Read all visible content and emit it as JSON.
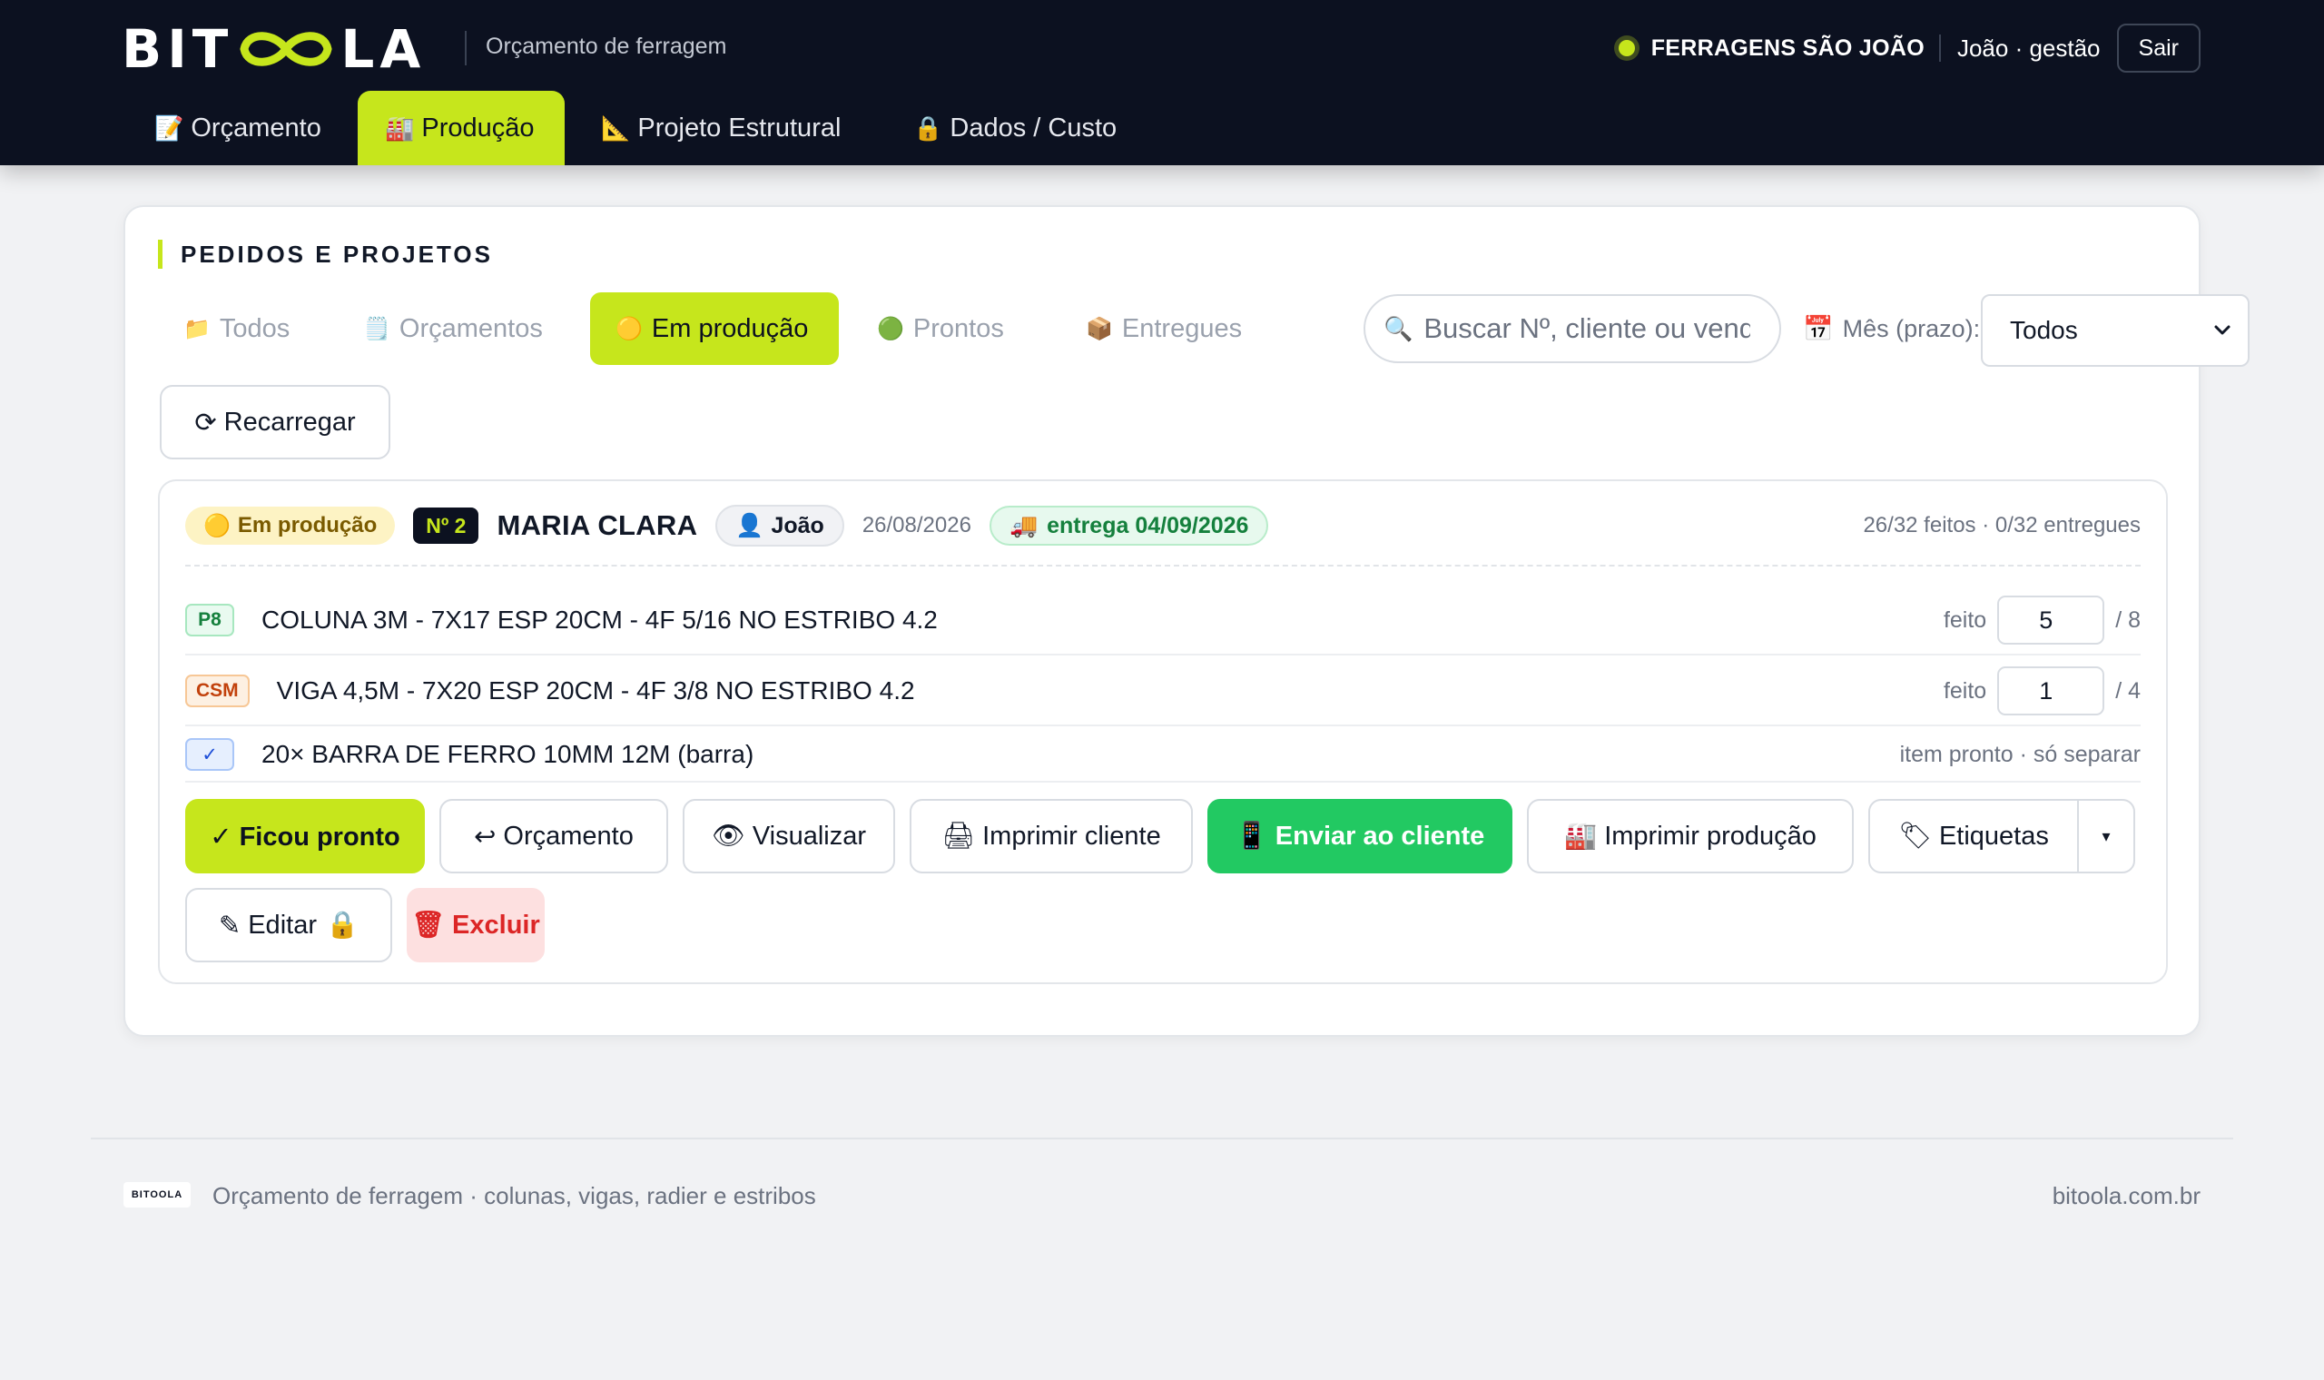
{
  "header": {
    "logo_left": "BIT",
    "logo_right": "LA",
    "tagline": "Orçamento de ferragem",
    "company": "FERRAGENS SÃO JOÃO",
    "user": "João · gestão",
    "logout_label": "Sair",
    "status_color": "#c6e61c"
  },
  "nav": {
    "tabs": [
      {
        "icon": "📝",
        "icon_name": "memo-icon",
        "label": "Orçamento"
      },
      {
        "icon": "🏭",
        "icon_name": "factory-icon",
        "label": "Produção",
        "active": true
      },
      {
        "icon": "📐",
        "icon_name": "triangle-ruler-icon",
        "label": "Projeto Estrutural"
      },
      {
        "icon": "🔒",
        "icon_name": "lock-icon",
        "label": "Dados / Custo"
      }
    ]
  },
  "main": {
    "section_title": "PEDIDOS E PROJETOS",
    "filters": [
      {
        "icon": "📁",
        "icon_name": "folder-icon",
        "label": "Todos"
      },
      {
        "icon": "🗒️",
        "icon_name": "notepad-icon",
        "label": "Orçamentos"
      },
      {
        "icon": "🟡",
        "icon_name": "yellow-circle-icon",
        "label": "Em produção",
        "active": true
      },
      {
        "icon": "🟢",
        "icon_name": "green-circle-icon",
        "label": "Prontos"
      },
      {
        "icon": "📦",
        "icon_name": "package-icon",
        "label": "Entregues"
      }
    ],
    "search": {
      "icon": "🔍",
      "placeholder": "Buscar Nº, cliente ou vendedor",
      "value": ""
    },
    "month": {
      "icon": "📅",
      "label": "Mês (prazo):",
      "selected": "Todos"
    },
    "reload": {
      "icon": "⟳",
      "label": "Recarregar"
    }
  },
  "order": {
    "status_icon": "🟡",
    "status": "Em produção",
    "number": "Nº 2",
    "client": "MARIA CLARA",
    "seller_icon": "👤",
    "seller": "João",
    "date": "26/08/2026",
    "delivery_icon": "🚚",
    "delivery": "entrega 04/09/2026",
    "progress": "26/32 feitos · 0/32 entregues",
    "items": [
      {
        "tag": "P8",
        "tag_color": "green",
        "desc": "COLUNA 3M - 7X17 ESP 20CM - 4F 5/16 NO ESTRIBO 4.2",
        "done_label": "feito",
        "done": "5",
        "total": "/ 8"
      },
      {
        "tag": "CSM",
        "tag_color": "orange",
        "desc": "VIGA 4,5M - 7X20 ESP 20CM - 4F 3/8 NO ESTRIBO 4.2",
        "done_label": "feito",
        "done": "1",
        "total": "/ 4"
      },
      {
        "tag": "✓",
        "tag_color": "blue",
        "desc": "20× BARRA DE FERRO 10MM 12M (barra)",
        "note": "item pronto · só separar"
      }
    ],
    "actions": {
      "ready": "✓ Ficou pronto",
      "quote_icon": "↩",
      "quote": "Orçamento",
      "view_icon": "👁",
      "view": "Visualizar",
      "print_client_icon": "🖨",
      "print_client": "Imprimir cliente",
      "send_client_icon": "📱",
      "send_client": "Enviar ao cliente",
      "print_production_icon": "🏭",
      "print_production": "Imprimir produção",
      "labels_icon": "🏷",
      "labels": "Etiquetas",
      "labels_menu": "▾",
      "edit_icon": "✎",
      "edit": "Editar",
      "edit_lock": "🔒",
      "delete_icon": "🗑",
      "delete": "Excluir"
    }
  },
  "footer": {
    "logo": "BITOOLA",
    "text": "Orçamento de ferragem · colunas, vigas, radier e estribos",
    "site": "bitoola.com.br"
  }
}
